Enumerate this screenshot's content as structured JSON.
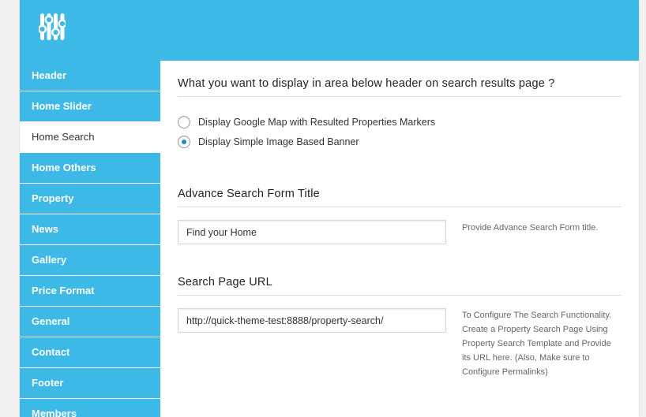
{
  "sidebar": {
    "items": [
      {
        "label": "Header",
        "active": false
      },
      {
        "label": "Home Slider",
        "active": false
      },
      {
        "label": "Home Search",
        "active": true
      },
      {
        "label": "Home Others",
        "active": false
      },
      {
        "label": "Property",
        "active": false
      },
      {
        "label": "News",
        "active": false
      },
      {
        "label": "Gallery",
        "active": false
      },
      {
        "label": "Price Format",
        "active": false
      },
      {
        "label": "General",
        "active": false
      },
      {
        "label": "Contact",
        "active": false
      },
      {
        "label": "Footer",
        "active": false
      },
      {
        "label": "Members",
        "active": false
      }
    ]
  },
  "header": {
    "logo_icon": "sliders-icon",
    "accent_color": "#3db9e8"
  },
  "sections": {
    "display_area": {
      "title": "What you want to display in area below header on search results page ?",
      "options": [
        {
          "label": "Display Google Map with Resulted Properties Markers",
          "checked": false
        },
        {
          "label": "Display Simple Image Based Banner",
          "checked": true
        }
      ]
    },
    "form_title": {
      "title": "Advance Search Form Title",
      "value": "Find your Home",
      "help": "Provide Advance Search Form title."
    },
    "search_url": {
      "title": "Search Page URL",
      "value": "http://quick-theme-test:8888/property-search/",
      "help": "To Configure The Search Functionality. Create a Property Search Page Using Property Search Template and Provide its URL here. (Also, Make sure to Configure Permalinks)"
    }
  }
}
